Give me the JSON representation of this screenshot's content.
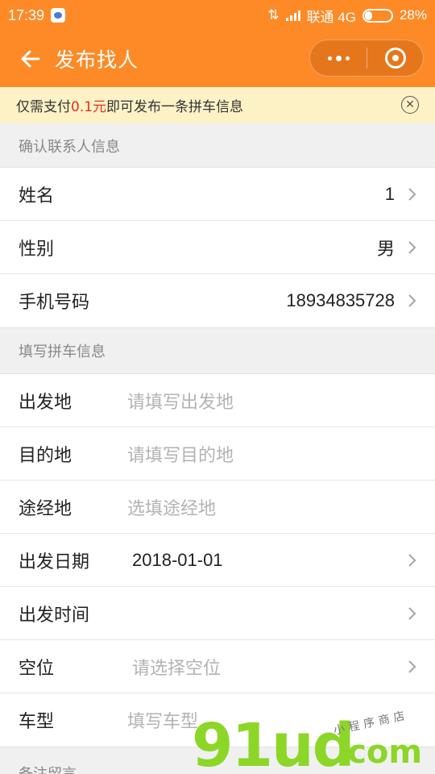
{
  "status_bar": {
    "time": "17:39",
    "carrier": "联通 4G",
    "battery": "28%",
    "battery_level": 0.28
  },
  "nav": {
    "title": "发布找人"
  },
  "notice": {
    "prefix": "仅需支付",
    "price": "0.1元",
    "suffix": "即可发布一条拼车信息"
  },
  "contact_section": {
    "title": "确认联系人信息",
    "rows": [
      {
        "label": "姓名",
        "value": "1"
      },
      {
        "label": "性别",
        "value": "男"
      },
      {
        "label": "手机号码",
        "value": "18934835728"
      }
    ]
  },
  "ride_section": {
    "title": "填写拼车信息",
    "departure": {
      "label": "出发地",
      "placeholder": "请填写出发地"
    },
    "destination": {
      "label": "目的地",
      "placeholder": "请填写目的地"
    },
    "via": {
      "label": "途经地",
      "placeholder": "选填途经地"
    },
    "date": {
      "label": "出发日期",
      "value": "2018-01-01"
    },
    "time": {
      "label": "出发时间",
      "value": ""
    },
    "seats": {
      "label": "空位",
      "placeholder": "请选择空位"
    },
    "car_type": {
      "label": "车型",
      "placeholder": "填写车型"
    }
  },
  "remarks_section": {
    "title": "备注留言"
  },
  "watermark": {
    "brand": "91ud",
    "domain": ".com",
    "tagline": "小程序商店"
  },
  "colors": {
    "brand_orange": "#fd8a27",
    "notice_bg": "#fdf1c6",
    "price_red": "#e2321f"
  },
  "icons": [
    "message-icon",
    "signal-icon",
    "battery-icon",
    "back-arrow-icon",
    "more-dots-icon",
    "close-target-icon",
    "close-circle-icon",
    "chevron-right-icon"
  ]
}
